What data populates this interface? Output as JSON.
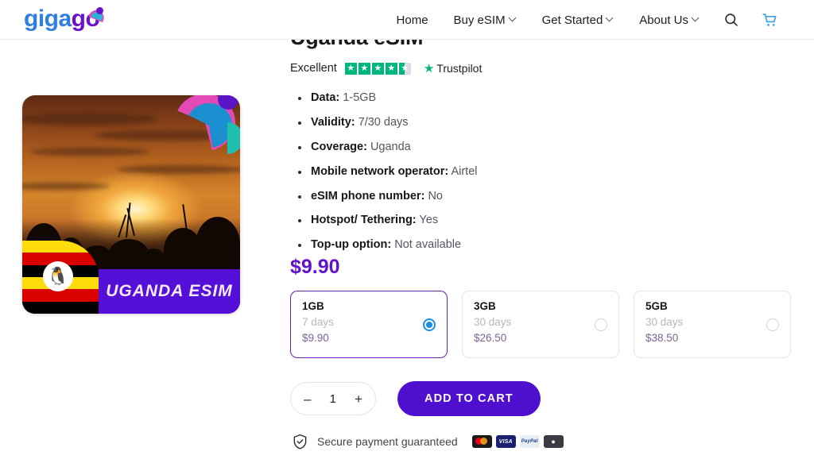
{
  "brand": {
    "logo_text_part1": "giga",
    "logo_text_part2": "go"
  },
  "header": {
    "nav": [
      {
        "label": "Home",
        "has_dropdown": false
      },
      {
        "label": "Buy eSIM",
        "has_dropdown": true
      },
      {
        "label": "Get Started",
        "has_dropdown": true
      },
      {
        "label": "About Us",
        "has_dropdown": true
      }
    ],
    "search_icon": "search-icon",
    "cart_icon": "shopping-cart-icon"
  },
  "product": {
    "title": "Uganda eSIM",
    "image_banner_text": "UGANDA ESIM",
    "image_alt": "Uganda sunset landscape with flag",
    "rating": {
      "word": "Excellent",
      "stars_filled": 4,
      "stars_total": 5,
      "half_star": true,
      "provider": "Trustpilot"
    },
    "specs": [
      {
        "label": "Data:",
        "value": "1-5GB"
      },
      {
        "label": "Validity:",
        "value": "7/30 days"
      },
      {
        "label": "Coverage:",
        "value": "Uganda"
      },
      {
        "label": "Mobile network operator:",
        "value": "Airtel"
      },
      {
        "label": "eSIM phone number:",
        "value": "No"
      },
      {
        "label": "Hotspot/ Tethering:",
        "value": "Yes"
      },
      {
        "label": "Top-up option:",
        "value": "Not available"
      }
    ],
    "price": "$9.90",
    "plans": [
      {
        "size": "1GB",
        "days": "7 days",
        "price": "$9.90",
        "selected": true
      },
      {
        "size": "3GB",
        "days": "30 days",
        "price": "$26.50",
        "selected": false
      },
      {
        "size": "5GB",
        "days": "30 days",
        "price": "$38.50",
        "selected": false
      }
    ],
    "quantity": {
      "decrement": "–",
      "value": "1",
      "increment": "+"
    },
    "add_to_cart_label": "ADD TO CART",
    "secure": {
      "icon": "shield-check-icon",
      "text": "Secure payment guaranteed",
      "payment_methods": [
        "Mastercard",
        "VISA",
        "PayPal",
        "Apple Pay"
      ],
      "payment_labels": [
        "",
        "VISA",
        "PayPal",
        ""
      ]
    }
  },
  "colors": {
    "brand_purple": "#6013c9",
    "add_to_cart": "#4f0fcf",
    "selected_border": "#6b24b8",
    "radio_blue": "#1a8fe8",
    "trustpilot_green": "#00b67a",
    "logo_blue": "#2f7fe0",
    "cart_blue": "#3b9fe8"
  }
}
